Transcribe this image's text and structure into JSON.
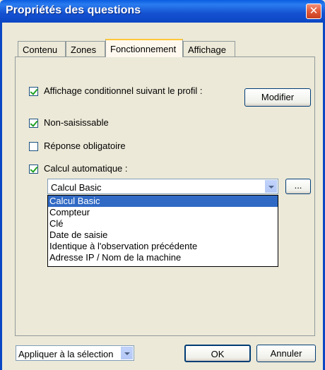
{
  "window": {
    "title": "Propriétés des questions",
    "close_glyph": "✕"
  },
  "tabs": [
    {
      "label": "Contenu",
      "active": false
    },
    {
      "label": "Zones",
      "active": false
    },
    {
      "label": "Fonctionnement",
      "active": true
    },
    {
      "label": "Affichage",
      "active": false
    }
  ],
  "page": {
    "conditional": {
      "label": "Affichage conditionnel suivant le profil :",
      "checked": true
    },
    "modify_button": "Modifier",
    "read_only": {
      "label": "Non-saisissable",
      "checked": true
    },
    "required": {
      "label": "Réponse obligatoire",
      "checked": false
    },
    "auto_calc": {
      "label": "Calcul automatique :",
      "checked": true
    },
    "calc_combo": {
      "value": "Calcul Basic"
    },
    "ellipsis_button": "...",
    "calc_options": [
      "Calcul Basic",
      "Compteur",
      "Clé",
      "Date de saisie",
      "Identique à l'observation précédente",
      "Adresse IP / Nom de la machine"
    ],
    "calc_selected_index": 0
  },
  "footer": {
    "apply_combo": "Appliquer à la sélection",
    "ok_button": "OK",
    "cancel_button": "Annuler"
  },
  "colors": {
    "titlebar": "#0b47c4",
    "dialog_bg": "#ece9d8",
    "selection": "#316ac5",
    "check": "#21a121",
    "close": "#e05a38"
  }
}
